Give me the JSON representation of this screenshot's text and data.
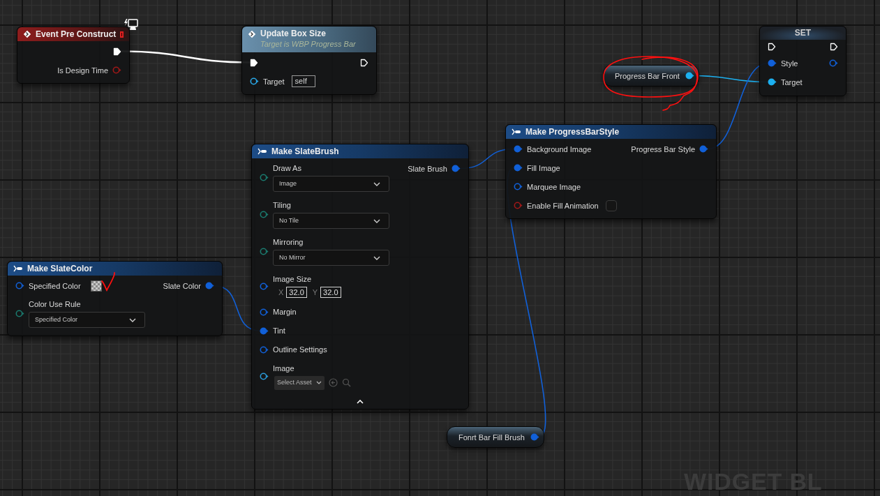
{
  "nodes": [
    {
      "kind": "event",
      "title": "Event Pre Construct",
      "outputs": [
        {
          "kind": "exec",
          "connected": true
        },
        {
          "kind": "data",
          "label": "Is Design Time",
          "connected": false,
          "color": "#a01818"
        }
      ]
    },
    {
      "kind": "function",
      "title": "Update Box Size",
      "subtitle": "Target is WBP Progress Bar",
      "inputs": [
        {
          "kind": "exec",
          "connected": true
        },
        {
          "kind": "data",
          "label": "Target",
          "connected": false,
          "color": "#2aa8e8",
          "widget": {
            "kind": "text",
            "value": "self"
          }
        }
      ],
      "outputs": [
        {
          "kind": "exec",
          "connected": false
        }
      ]
    },
    {
      "kind": "variable",
      "outputs": [
        {
          "kind": "data",
          "label": "Progress Bar Front",
          "connected": true,
          "color": "#1cb0f0"
        }
      ]
    },
    {
      "kind": "set",
      "title": "SET",
      "inputs": [
        {
          "kind": "exec",
          "connected": false
        },
        {
          "kind": "data",
          "label": "Style",
          "connected": true,
          "color": "#1160d8"
        },
        {
          "kind": "data",
          "label": "Target",
          "connected": true,
          "color": "#1cb0f0"
        }
      ],
      "outputs": [
        {
          "kind": "exec",
          "connected": false
        },
        {
          "kind": "data",
          "connected": false,
          "color": "#1160d8"
        }
      ]
    },
    {
      "kind": "pure",
      "title": "Make ProgressBarStyle",
      "inputs": [
        {
          "kind": "data",
          "label": "Background Image",
          "connected": true,
          "color": "#1160d8"
        },
        {
          "kind": "data",
          "label": "Fill Image",
          "connected": true,
          "color": "#1160d8"
        },
        {
          "kind": "data",
          "label": "Marquee Image",
          "connected": false,
          "color": "#1160d8"
        },
        {
          "kind": "data",
          "label": "Enable Fill Animation",
          "connected": false,
          "color": "#a01818",
          "widget": {
            "kind": "checkbox",
            "checked": false
          }
        }
      ],
      "outputs": [
        {
          "kind": "data",
          "label": "Progress Bar Style",
          "connected": true,
          "color": "#1160d8"
        }
      ]
    },
    {
      "kind": "pure",
      "title": "Make SlateBrush",
      "advanced_expanded": true,
      "inputs": [
        {
          "kind": "data",
          "label": "Draw As",
          "connected": false,
          "color": "#1a7a6e",
          "widget": {
            "kind": "dropdown",
            "value": "Image"
          }
        },
        {
          "kind": "data",
          "label": "Tiling",
          "connected": false,
          "color": "#1a7a6e",
          "widget": {
            "kind": "dropdown",
            "value": "No Tile"
          }
        },
        {
          "kind": "data",
          "label": "Mirroring",
          "connected": false,
          "color": "#1a7a6e",
          "widget": {
            "kind": "dropdown",
            "value": "No Mirror"
          }
        },
        {
          "kind": "data",
          "label": "Image Size",
          "connected": false,
          "color": "#1160d8",
          "widget": {
            "kind": "vector",
            "fields": [
              {
                "axis": "X",
                "value": "32.0"
              },
              {
                "axis": "Y",
                "value": "32.0"
              }
            ]
          }
        },
        {
          "kind": "data",
          "label": "Margin",
          "connected": false,
          "color": "#1160d8"
        },
        {
          "kind": "data",
          "label": "Tint",
          "connected": true,
          "color": "#1160d8"
        },
        {
          "kind": "data",
          "label": "Outline Settings",
          "connected": false,
          "color": "#1160d8"
        },
        {
          "kind": "data",
          "label": "Image",
          "connected": false,
          "color": "#2a9ad8",
          "widget": {
            "kind": "asset",
            "value": "Select Asset"
          }
        }
      ],
      "outputs": [
        {
          "kind": "data",
          "label": "Slate Brush",
          "connected": true,
          "color": "#1160d8"
        }
      ]
    },
    {
      "kind": "pure",
      "title": "Make SlateColor",
      "inputs": [
        {
          "kind": "data",
          "label": "Specified Color",
          "connected": false,
          "color": "#1160d8",
          "widget": {
            "kind": "swatch"
          }
        },
        {
          "kind": "data",
          "label": "Color Use Rule",
          "connected": false,
          "color": "#1a7a6e",
          "widget": {
            "kind": "dropdown",
            "value": "Specified Color"
          }
        }
      ],
      "outputs": [
        {
          "kind": "data",
          "label": "Slate Color",
          "connected": true,
          "color": "#1160d8"
        }
      ]
    },
    {
      "kind": "variable",
      "outputs": [
        {
          "kind": "data",
          "label": "Fonrt Bar Fill Brush",
          "connected": true,
          "color": "#1160d8"
        }
      ]
    }
  ],
  "graph_label": "WIDGET BL"
}
